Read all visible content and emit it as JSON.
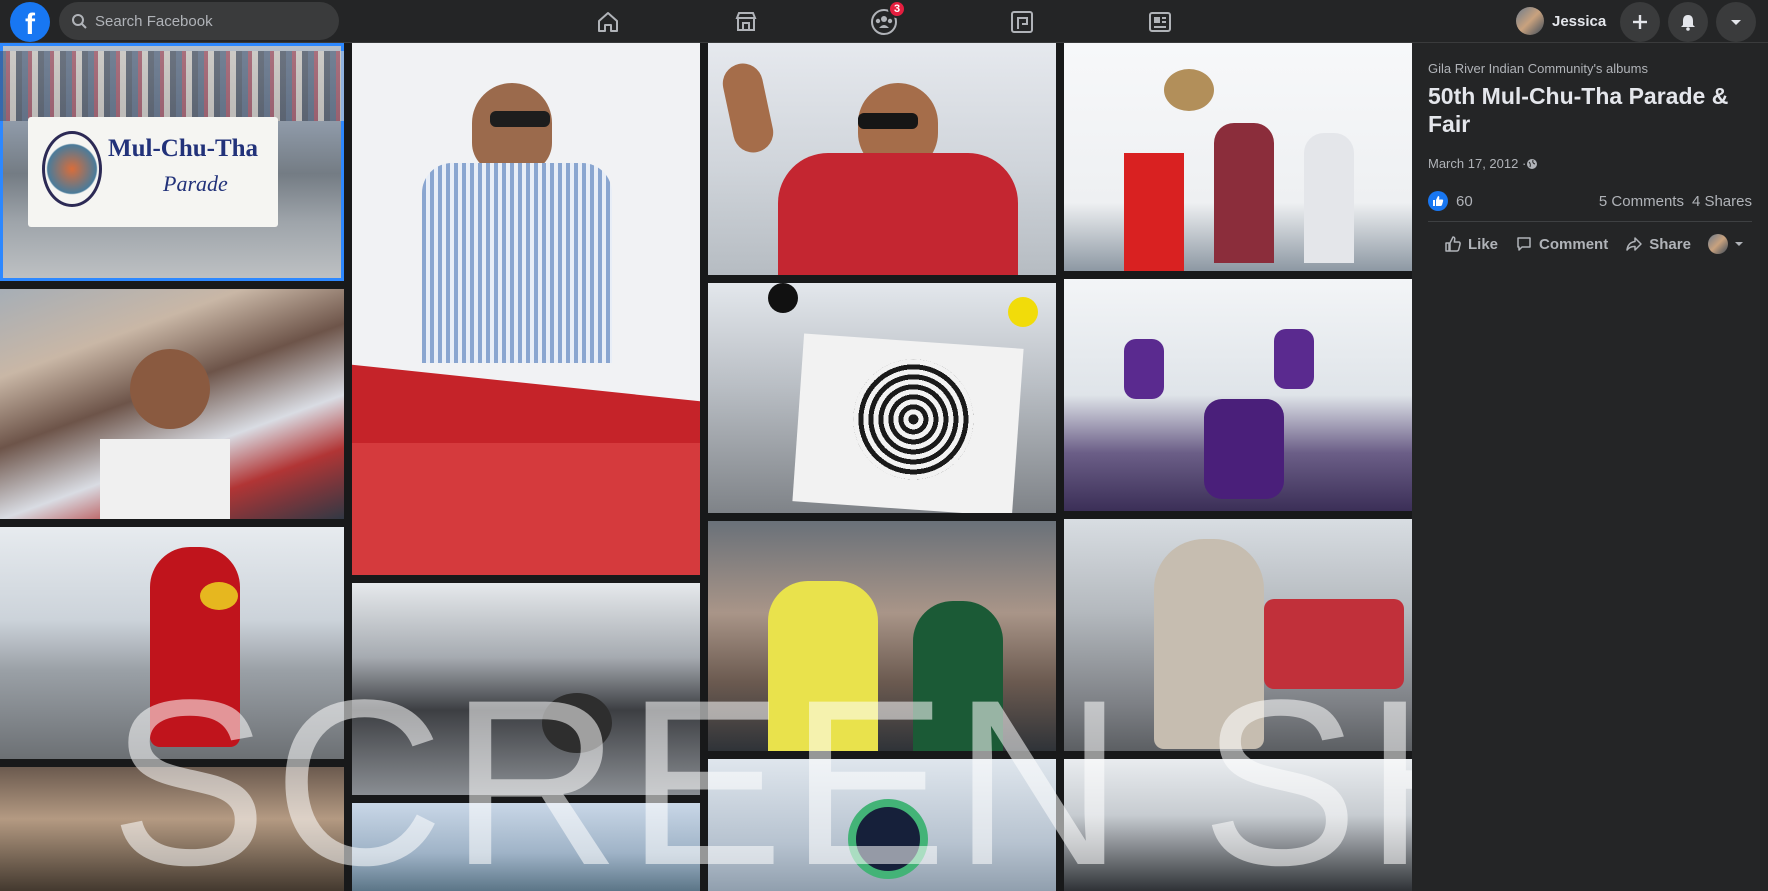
{
  "topbar": {
    "logo_letter": "f",
    "search_placeholder": "Search Facebook",
    "nav_icons": [
      "home-icon",
      "marketplace-icon",
      "groups-icon",
      "gaming-icon",
      "news-icon"
    ],
    "groups_badge": "3",
    "user_name": "Jessica",
    "right_icons": [
      "plus-icon",
      "notifications-icon",
      "chevron-down-icon"
    ]
  },
  "album": {
    "breadcrumb": "Gila River Indian Community's albums",
    "title": "50th Mul-Chu-Tha Parade & Fair",
    "date": "March 17, 2012 · ",
    "reactions_count": "60",
    "comments": "5 Comments",
    "shares": "4 Shares",
    "like_label": "Like",
    "comment_label": "Comment",
    "share_label": "Share"
  },
  "photos": {
    "banner_line1": "Mul-Chu-Tha",
    "banner_line2": "Parade",
    "selected_index": 0
  },
  "watermark": "SCREEN SHOT",
  "colors": {
    "accent": "#1877f2",
    "badge": "#e41e3f",
    "panel_bg": "#242526",
    "page_bg": "#18191a"
  }
}
